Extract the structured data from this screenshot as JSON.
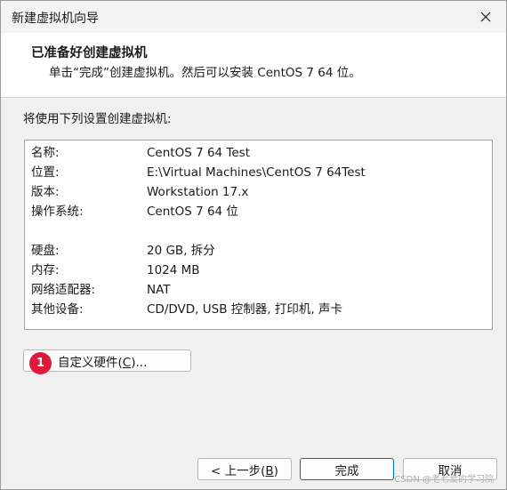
{
  "window": {
    "title": "新建虚拟机向导"
  },
  "header": {
    "title": "已准备好创建虚拟机",
    "subtitle": "单击“完成”创建虚拟机。然后可以安装 CentOS 7 64 位。"
  },
  "intro": "将使用下列设置创建虚拟机:",
  "settings": [
    {
      "label": "名称:",
      "value": "CentOS 7 64 Test"
    },
    {
      "label": "位置:",
      "value": "E:\\Virtual Machines\\CentOS 7 64Test"
    },
    {
      "label": "版本:",
      "value": "Workstation 17.x"
    },
    {
      "label": "操作系统:",
      "value": "CentOS 7 64 位"
    },
    {
      "label": "硬盘:",
      "value": "20 GB, 拆分"
    },
    {
      "label": "内存:",
      "value": "1024 MB"
    },
    {
      "label": "网络适配器:",
      "value": "NAT"
    },
    {
      "label": "其他设备:",
      "value": "CD/DVD, USB 控制器, 打印机, 声卡"
    }
  ],
  "buttons": {
    "customize_text": "自定义硬件(",
    "customize_key": "C",
    "customize_suffix": ")...",
    "back_prefix": "< 上一步(",
    "back_key": "B",
    "back_suffix": ")",
    "finish": "完成",
    "cancel": "取消"
  },
  "badge": "1",
  "watermark": "CSDN @老七爱的学习院"
}
